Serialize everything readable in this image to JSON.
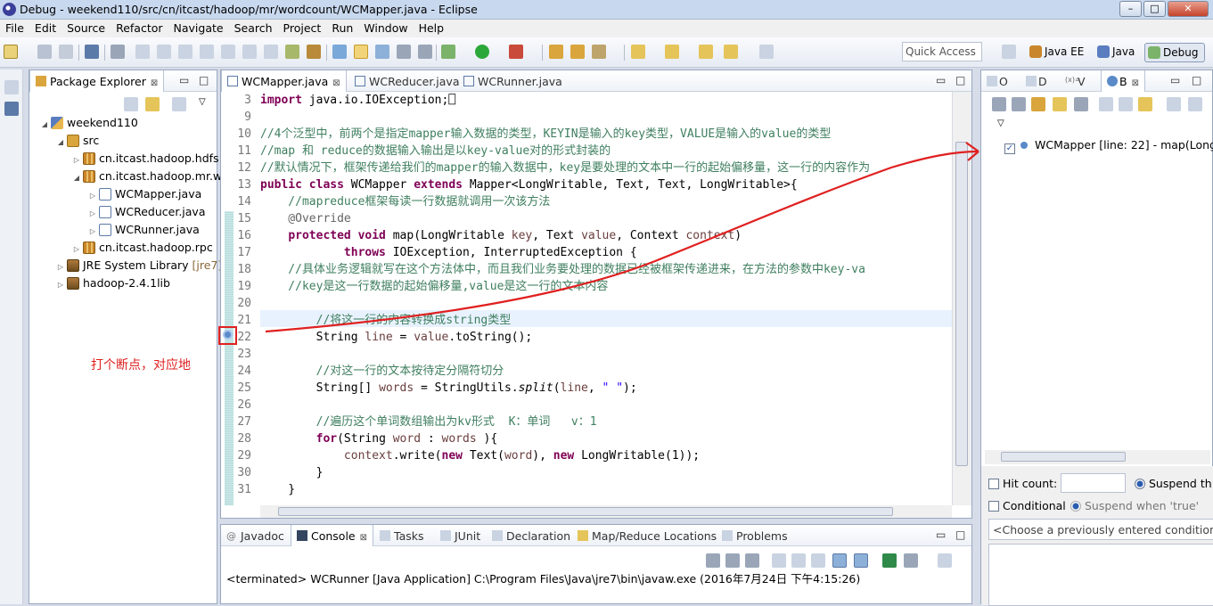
{
  "window": {
    "title": "Debug - weekend110/src/cn/itcast/hadoop/mr/wordcount/WCMapper.java - Eclipse",
    "minimize": "–",
    "maximize": "□",
    "close": "✕"
  },
  "menu": [
    "File",
    "Edit",
    "Source",
    "Refactor",
    "Navigate",
    "Search",
    "Project",
    "Run",
    "Window",
    "Help"
  ],
  "toolbar": {
    "quick_access_placeholder": "Quick Access",
    "perspectives": [
      "Java EE",
      "Java",
      "Debug"
    ]
  },
  "package_explorer": {
    "tab_label": "Package Explorer",
    "tree": [
      {
        "label": "weekend110",
        "icon": "project-icon"
      },
      {
        "label": "src",
        "icon": "source-folder-icon"
      },
      {
        "label": "cn.itcast.hadoop.hdfs",
        "icon": "package-icon"
      },
      {
        "label": "cn.itcast.hadoop.mr.w",
        "icon": "package-icon"
      },
      {
        "label": "WCMapper.java",
        "icon": "java-file-icon"
      },
      {
        "label": "WCReducer.java",
        "icon": "java-file-icon"
      },
      {
        "label": "WCRunner.java",
        "icon": "java-file-icon"
      },
      {
        "label": "cn.itcast.hadoop.rpc",
        "icon": "package-icon"
      },
      {
        "label": "JRE System Library",
        "decoration": "[jre7]",
        "icon": "library-icon"
      },
      {
        "label": "hadoop-2.4.1lib",
        "icon": "library-icon"
      }
    ]
  },
  "editor": {
    "tabs": [
      "WCMapper.java",
      "WCReducer.java",
      "WCRunner.java"
    ],
    "lines": [
      {
        "n": "3",
        "segs": [
          {
            "t": "import ",
            "c": "kw"
          },
          {
            "t": "java.io.IOException;⎕"
          }
        ]
      },
      {
        "n": "9",
        "segs": []
      },
      {
        "n": "10",
        "segs": [
          {
            "t": "//4个泛型中，前两个是指定mapper输入数据的类型，KEYIN是输入的key类型，VALUE是输入的value的类型",
            "c": "cm"
          }
        ]
      },
      {
        "n": "11",
        "segs": [
          {
            "t": "//map 和 reduce的数据输入输出是以key-value对的形式封装的",
            "c": "cm"
          }
        ]
      },
      {
        "n": "12",
        "segs": [
          {
            "t": "//默认情况下，框架传递给我们的mapper的输入数据中，key是要处理的文本中一行的起始偏移量，这一行的内容作为",
            "c": "cm"
          }
        ]
      },
      {
        "n": "13",
        "segs": [
          {
            "t": "public class ",
            "c": "kw"
          },
          {
            "t": "WCMapper "
          },
          {
            "t": "extends ",
            "c": "kw"
          },
          {
            "t": "Mapper<LongWritable, Text, Text, LongWritable>{"
          }
        ]
      },
      {
        "n": "14",
        "segs": [
          {
            "t": "    //mapreduce框架每读一行数据就调用一次该方法",
            "c": "cm"
          }
        ]
      },
      {
        "n": "15",
        "segs": [
          {
            "t": "    @Override",
            "c": "ann"
          }
        ]
      },
      {
        "n": "16",
        "segs": [
          {
            "t": "    "
          },
          {
            "t": "protected void ",
            "c": "kw"
          },
          {
            "t": "map(LongWritable "
          },
          {
            "t": "key",
            "c": "fld"
          },
          {
            "t": ", Text "
          },
          {
            "t": "value",
            "c": "fld"
          },
          {
            "t": ", Context "
          },
          {
            "t": "context",
            "c": "fld"
          },
          {
            "t": ")"
          }
        ]
      },
      {
        "n": "17",
        "segs": [
          {
            "t": "            "
          },
          {
            "t": "throws ",
            "c": "kw"
          },
          {
            "t": "IOException, InterruptedException {"
          }
        ]
      },
      {
        "n": "18",
        "segs": [
          {
            "t": "    //具体业务逻辑就写在这个方法体中，而且我们业务要处理的数据已经被框架传递进来，在方法的参数中key-va",
            "c": "cm"
          }
        ]
      },
      {
        "n": "19",
        "segs": [
          {
            "t": "    //key是这一行数据的起始偏移量,value是这一行的文本内容",
            "c": "cm"
          }
        ]
      },
      {
        "n": "20",
        "segs": []
      },
      {
        "n": "21",
        "segs": [
          {
            "t": "        //将这一行的内容转换成string类型",
            "c": "cm"
          }
        ]
      },
      {
        "n": "22",
        "segs": [
          {
            "t": "        String "
          },
          {
            "t": "line",
            "c": "fld"
          },
          {
            "t": " = "
          },
          {
            "t": "value",
            "c": "fld"
          },
          {
            "t": ".toString();"
          }
        ]
      },
      {
        "n": "23",
        "segs": []
      },
      {
        "n": "24",
        "segs": [
          {
            "t": "        //对这一行的文本按待定分隔符切分",
            "c": "cm"
          }
        ]
      },
      {
        "n": "25",
        "segs": [
          {
            "t": "        String[] "
          },
          {
            "t": "words",
            "c": "fld"
          },
          {
            "t": " = StringUtils."
          },
          {
            "t": "split",
            "c": "it"
          },
          {
            "t": "("
          },
          {
            "t": "line",
            "c": "fld"
          },
          {
            "t": ", "
          },
          {
            "t": "\" \"",
            "c": "str"
          },
          {
            "t": ");"
          }
        ]
      },
      {
        "n": "26",
        "segs": []
      },
      {
        "n": "27",
        "segs": [
          {
            "t": "        //遍历这个单词数组输出为kv形式  K：单词   v：1",
            "c": "cm"
          }
        ]
      },
      {
        "n": "28",
        "segs": [
          {
            "t": "        "
          },
          {
            "t": "for",
            "c": "kw"
          },
          {
            "t": "(String "
          },
          {
            "t": "word",
            "c": "fld"
          },
          {
            "t": " : "
          },
          {
            "t": "words",
            "c": "fld"
          },
          {
            "t": " ){"
          }
        ]
      },
      {
        "n": "29",
        "segs": [
          {
            "t": "            "
          },
          {
            "t": "context",
            "c": "fld"
          },
          {
            "t": ".write("
          },
          {
            "t": "new ",
            "c": "kw"
          },
          {
            "t": "Text("
          },
          {
            "t": "word",
            "c": "fld"
          },
          {
            "t": "), "
          },
          {
            "t": "new ",
            "c": "kw"
          },
          {
            "t": "LongWritable(1));"
          }
        ]
      },
      {
        "n": "30",
        "segs": [
          {
            "t": "        }"
          }
        ]
      },
      {
        "n": "31",
        "segs": [
          {
            "t": "    }"
          }
        ]
      }
    ]
  },
  "annotation": "打个断点，对应地",
  "bottom_panel": {
    "tabs": [
      "Javadoc",
      "Console",
      "Tasks",
      "JUnit",
      "Declaration",
      "Map/Reduce Locations",
      "Problems"
    ],
    "console_line": "<terminated> WCRunner [Java Application] C:\\Program Files\\Java\\jre7\\bin\\javaw.exe (2016年7月24日 下午4:15:26)"
  },
  "breakpoints": {
    "tabs": [
      "O",
      "D",
      "V",
      "B"
    ],
    "item": "WCMapper [line: 22] - map(Long",
    "hit_count_label": "Hit count:",
    "suspend_label": "Suspend th",
    "conditional_label": "Conditional",
    "suspend_true_label": "Suspend when 'true'",
    "condition_placeholder": "<Choose a previously entered condition>"
  }
}
